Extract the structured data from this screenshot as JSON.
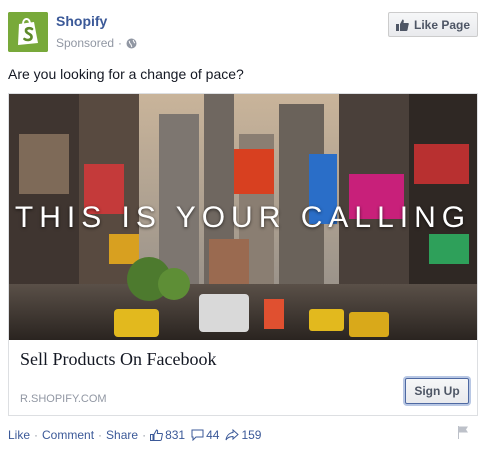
{
  "page": {
    "name": "Shopify",
    "sponsored_label": "Sponsored",
    "separator": "·",
    "like_page_label": "Like Page",
    "logo_icon": "shopify-bag-icon"
  },
  "post": {
    "message": "Are you looking for a change of pace?"
  },
  "ad": {
    "image_headline": "THIS IS YOUR CALLING",
    "title": "Sell Products On Facebook",
    "domain": "R.SHOPIFY.COM",
    "cta_label": "Sign Up",
    "image_description_icon": "times-square-photo"
  },
  "actions": {
    "like_label": "Like",
    "comment_label": "Comment",
    "share_label": "Share",
    "separator": "·",
    "like_count": "831",
    "comment_count": "44",
    "share_count": "159"
  },
  "colors": {
    "brand_blue": "#3b5998",
    "shopify_green": "#78a93a",
    "muted_gray": "#9197a3"
  }
}
